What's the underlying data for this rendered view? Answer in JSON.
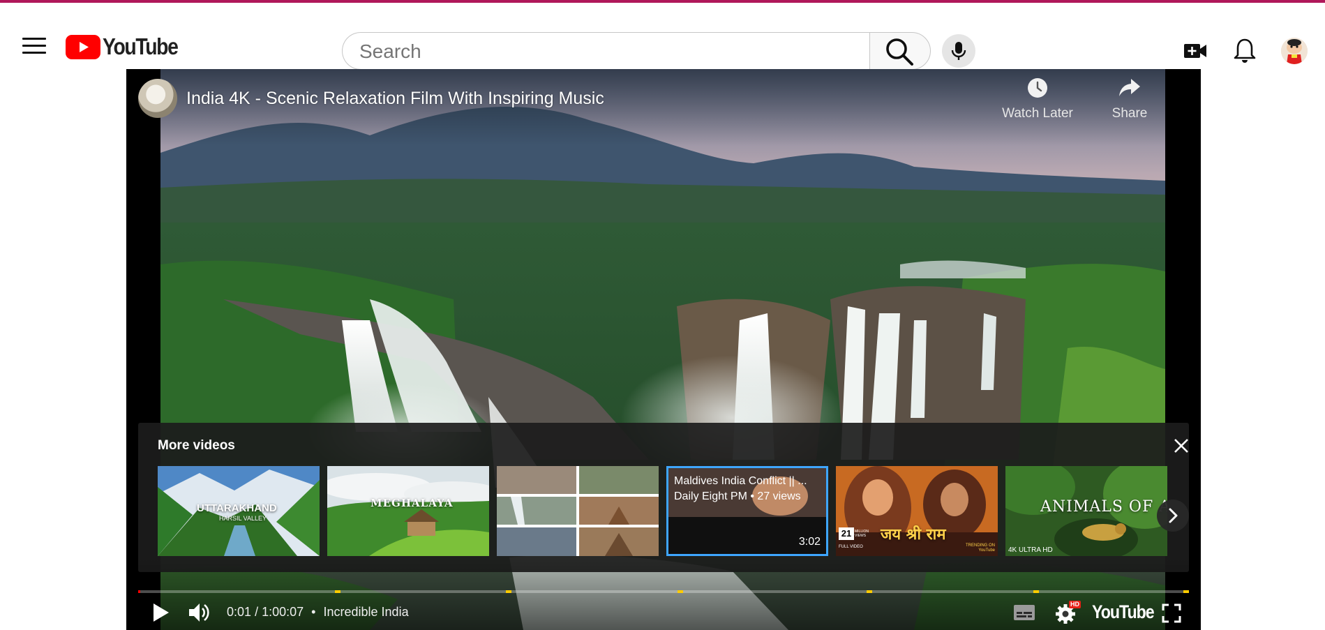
{
  "masthead": {
    "logo_text": "YouTube",
    "search_placeholder": "Search"
  },
  "player": {
    "video_title": "India 4K - Scenic Relaxation Film With Inspiring Music",
    "watch_later_label": "Watch Later",
    "share_label": "Share",
    "current_time": "0:01",
    "separator": "/",
    "duration": "1:00:07",
    "chapter_title": "Incredible India",
    "progress_fraction": 0.0003,
    "settings_badge": "HD",
    "wordmark": "YouTube"
  },
  "more_videos": {
    "title": "More videos",
    "items": [
      {
        "overlay_title": "UTTARAKHAND",
        "overlay_subtitle": "HARSIL VALLEY"
      },
      {
        "overlay_title": "MEGHALAYA"
      },
      {
        "overlay_title": ""
      },
      {
        "title": "Maldives India Conflict || ...",
        "meta": "Daily Eight PM • 27 views",
        "duration": "3:02"
      },
      {
        "overlay_title": "जय श्री राम",
        "badge_number": "21",
        "badge_text": "MILLION VIEWS",
        "footer_left": "FULL VIDEO",
        "footer_right": "TRENDING ON YouTube"
      },
      {
        "overlay_title": "ANIMALS OF AMAZON",
        "corner_text": "4K ULTRA HD"
      }
    ]
  },
  "colors": {
    "accent_red": "#ff0000",
    "chapter_marker": "#ffcc00",
    "hover_outline": "#3ea6ff",
    "top_line": "#b0185a"
  }
}
